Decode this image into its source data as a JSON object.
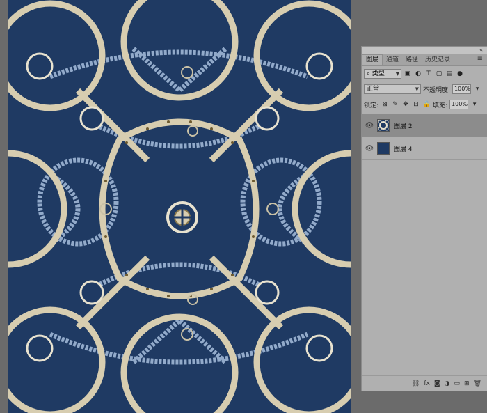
{
  "colors": {
    "canvas_bg": "#1f3a63",
    "workspace": "#6b6b6b",
    "chain_gold": "#d7cdb0",
    "chain_blue": "#9fb7d6",
    "panel_bg": "#b0b0b0",
    "selected_layer": "#8c8c8c"
  },
  "panel": {
    "tabs": [
      {
        "label": "图层",
        "active": true
      },
      {
        "label": "通道",
        "active": false
      },
      {
        "label": "路径",
        "active": false
      },
      {
        "label": "历史记录",
        "active": false
      }
    ],
    "filter": {
      "value": "类型"
    },
    "blend": {
      "mode": "正常",
      "opacity_label": "不透明度:",
      "opacity_value": "100%"
    },
    "lock": {
      "label": "锁定:",
      "fill_label": "填充:",
      "fill_value": "100%"
    },
    "layers": [
      {
        "name": "图层 2",
        "selected": true
      },
      {
        "name": "图层 4",
        "selected": false
      }
    ],
    "footer_icons": [
      "link-icon",
      "fx-icon",
      "mask-icon",
      "adjustment-icon",
      "group-icon",
      "new-layer-icon",
      "trash-icon"
    ],
    "footer_fx": "fx"
  }
}
